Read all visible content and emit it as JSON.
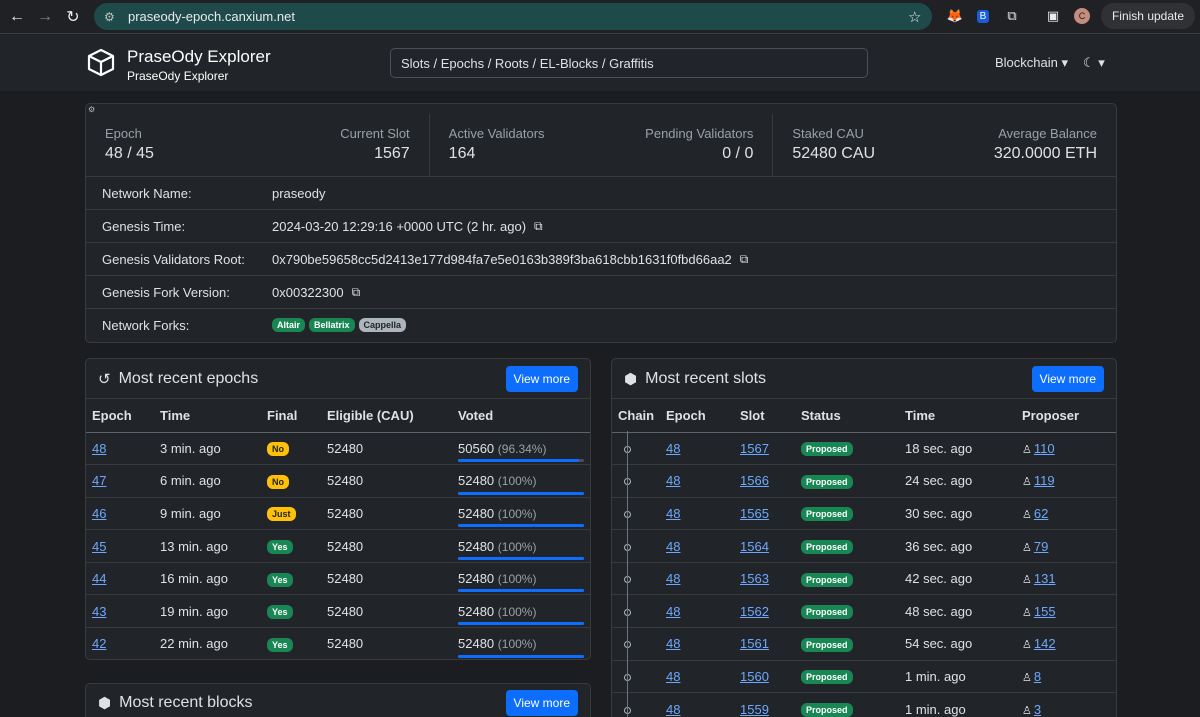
{
  "browser": {
    "url": "praseody-epoch.canxium.net",
    "finish_update": "Finish update",
    "profile_initial": "C"
  },
  "header": {
    "title": "PraseOdy Explorer",
    "subtitle": "PraseOdy Explorer",
    "search_placeholder": "Slots / Epochs / Roots / EL-Blocks / Graffitis",
    "nav_blockchain": "Blockchain ▾",
    "nav_theme": "☾ ▾"
  },
  "overview": {
    "stats": [
      [
        {
          "label": "Epoch",
          "value": "48 / 45"
        },
        {
          "label": "Current Slot",
          "value": "1567"
        }
      ],
      [
        {
          "label": "Active Validators",
          "value": "164"
        },
        {
          "label": "Pending Validators",
          "value": "0 / 0"
        }
      ],
      [
        {
          "label": "Staked CAU",
          "value": "52480 CAU"
        },
        {
          "label": "Average Balance",
          "value": "320.0000 ETH"
        }
      ]
    ],
    "props": [
      {
        "key": "Network Name:",
        "value": "praseody",
        "copy": false
      },
      {
        "key": "Genesis Time:",
        "value": "2024-03-20 12:29:16 +0000 UTC (2 hr. ago)",
        "copy": true
      },
      {
        "key": "Genesis Validators Root:",
        "value": "0x790be59658cc5d2413e177d984fa7e5e0163b389f3ba618cbb1631f0fbd66aa2",
        "copy": true
      },
      {
        "key": "Genesis Fork Version:",
        "value": "0x00322300",
        "copy": true
      }
    ],
    "forks_label": "Network Forks:",
    "forks": [
      {
        "name": "Altair",
        "color": "#198754"
      },
      {
        "name": "Bellatrix",
        "color": "#198754"
      },
      {
        "name": "Cappella",
        "color": "#adb5bd"
      }
    ]
  },
  "epochs_panel": {
    "title": "Most recent epochs",
    "view_more": "View more",
    "columns": [
      "Epoch",
      "Time",
      "Final",
      "Eligible (CAU)",
      "Voted"
    ],
    "rows": [
      {
        "epoch": "48",
        "time": "3 min. ago",
        "final": "No",
        "final_color": "#ffc107",
        "eligible": "52480",
        "voted": "50560",
        "pct": "(96.34%)",
        "fraction": 0.9634
      },
      {
        "epoch": "47",
        "time": "6 min. ago",
        "final": "No",
        "final_color": "#ffc107",
        "eligible": "52480",
        "voted": "52480",
        "pct": "(100%)",
        "fraction": 1
      },
      {
        "epoch": "46",
        "time": "9 min. ago",
        "final": "Just",
        "final_color": "#ffc107",
        "eligible": "52480",
        "voted": "52480",
        "pct": "(100%)",
        "fraction": 1
      },
      {
        "epoch": "45",
        "time": "13 min. ago",
        "final": "Yes",
        "final_color": "#198754",
        "eligible": "52480",
        "voted": "52480",
        "pct": "(100%)",
        "fraction": 1
      },
      {
        "epoch": "44",
        "time": "16 min. ago",
        "final": "Yes",
        "final_color": "#198754",
        "eligible": "52480",
        "voted": "52480",
        "pct": "(100%)",
        "fraction": 1
      },
      {
        "epoch": "43",
        "time": "19 min. ago",
        "final": "Yes",
        "final_color": "#198754",
        "eligible": "52480",
        "voted": "52480",
        "pct": "(100%)",
        "fraction": 1
      },
      {
        "epoch": "42",
        "time": "22 min. ago",
        "final": "Yes",
        "final_color": "#198754",
        "eligible": "52480",
        "voted": "52480",
        "pct": "(100%)",
        "fraction": 1
      }
    ]
  },
  "blocks_panel": {
    "title": "Most recent blocks",
    "view_more": "View more"
  },
  "slots_panel": {
    "title": "Most recent slots",
    "view_more": "View more",
    "columns": [
      "Chain",
      "Epoch",
      "Slot",
      "Status",
      "Time",
      "Proposer"
    ],
    "rows": [
      {
        "epoch": "48",
        "slot": "1567",
        "status": "Proposed",
        "time": "18 sec. ago",
        "proposer": "110"
      },
      {
        "epoch": "48",
        "slot": "1566",
        "status": "Proposed",
        "time": "24 sec. ago",
        "proposer": "119"
      },
      {
        "epoch": "48",
        "slot": "1565",
        "status": "Proposed",
        "time": "30 sec. ago",
        "proposer": "62"
      },
      {
        "epoch": "48",
        "slot": "1564",
        "status": "Proposed",
        "time": "36 sec. ago",
        "proposer": "79"
      },
      {
        "epoch": "48",
        "slot": "1563",
        "status": "Proposed",
        "time": "42 sec. ago",
        "proposer": "131"
      },
      {
        "epoch": "48",
        "slot": "1562",
        "status": "Proposed",
        "time": "48 sec. ago",
        "proposer": "155"
      },
      {
        "epoch": "48",
        "slot": "1561",
        "status": "Proposed",
        "time": "54 sec. ago",
        "proposer": "142"
      },
      {
        "epoch": "48",
        "slot": "1560",
        "status": "Proposed",
        "time": "1 min. ago",
        "proposer": "8"
      },
      {
        "epoch": "48",
        "slot": "1559",
        "status": "Proposed",
        "time": "1 min. ago",
        "proposer": "3"
      }
    ]
  }
}
